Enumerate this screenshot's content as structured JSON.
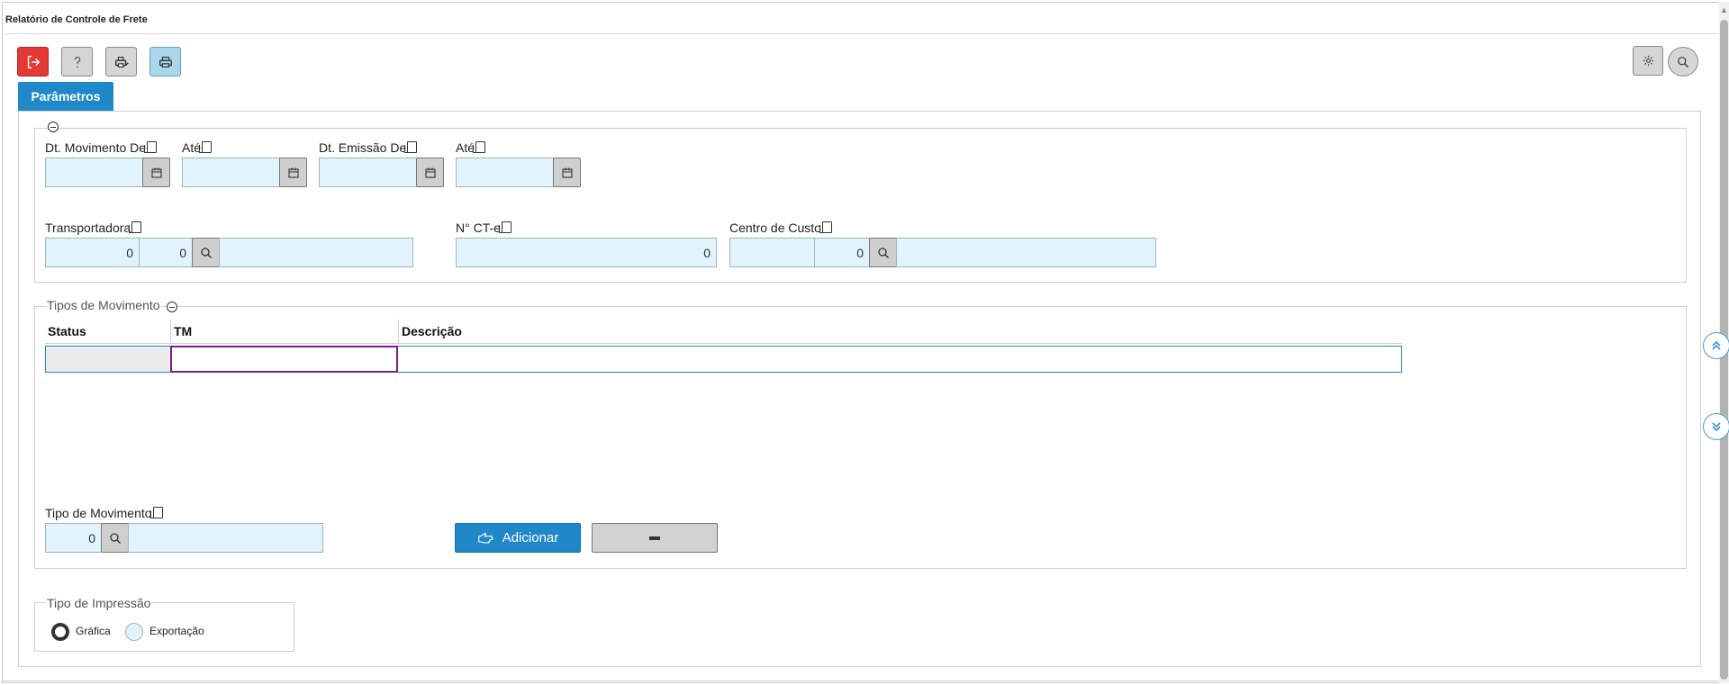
{
  "window": {
    "title": "Relatório de Controle de Frete"
  },
  "toolbar": {
    "exit_icon": "exit-icon",
    "help_icon": "help-icon",
    "print_preview_icon": "print-preview-icon",
    "print_icon": "print-icon",
    "settings_icon": "gear-icon",
    "search_icon": "search-icon"
  },
  "tabs": [
    {
      "label": "Parâmetros",
      "active": true
    }
  ],
  "params": {
    "dt_movimento_de": {
      "label": "Dt. Movimento De",
      "value": ""
    },
    "dt_movimento_ate": {
      "label": "Até",
      "value": ""
    },
    "dt_emissao_de": {
      "label": "Dt. Emissão De",
      "value": ""
    },
    "dt_emissao_ate": {
      "label": "Até",
      "value": ""
    },
    "transportadora": {
      "label": "Transportadora",
      "code1": "0",
      "code2": "0",
      "description": ""
    },
    "n_cte": {
      "label": "N° CT-e",
      "value": "0"
    },
    "centro_custo": {
      "label": "Centro de Custo",
      "code1": "",
      "code2": "0",
      "description": ""
    }
  },
  "tipos_movimento": {
    "legend": "Tipos de Movimento",
    "columns": [
      "Status",
      "TM",
      "Descrição"
    ],
    "rows": [
      {
        "status": "",
        "tm": "",
        "descricao": ""
      }
    ],
    "tipo_movimento": {
      "label": "Tipo de Movimento",
      "code": "0",
      "description": ""
    },
    "add_label": "Adicionar"
  },
  "tipo_impressao": {
    "legend": "Tipo de Impressão",
    "options": [
      {
        "label": "Gráfica",
        "selected": true
      },
      {
        "label": "Exportação",
        "selected": false
      }
    ]
  },
  "colors": {
    "accent": "#1e88c8",
    "exit": "#e53935",
    "input_bg": "#e2f4fb"
  }
}
